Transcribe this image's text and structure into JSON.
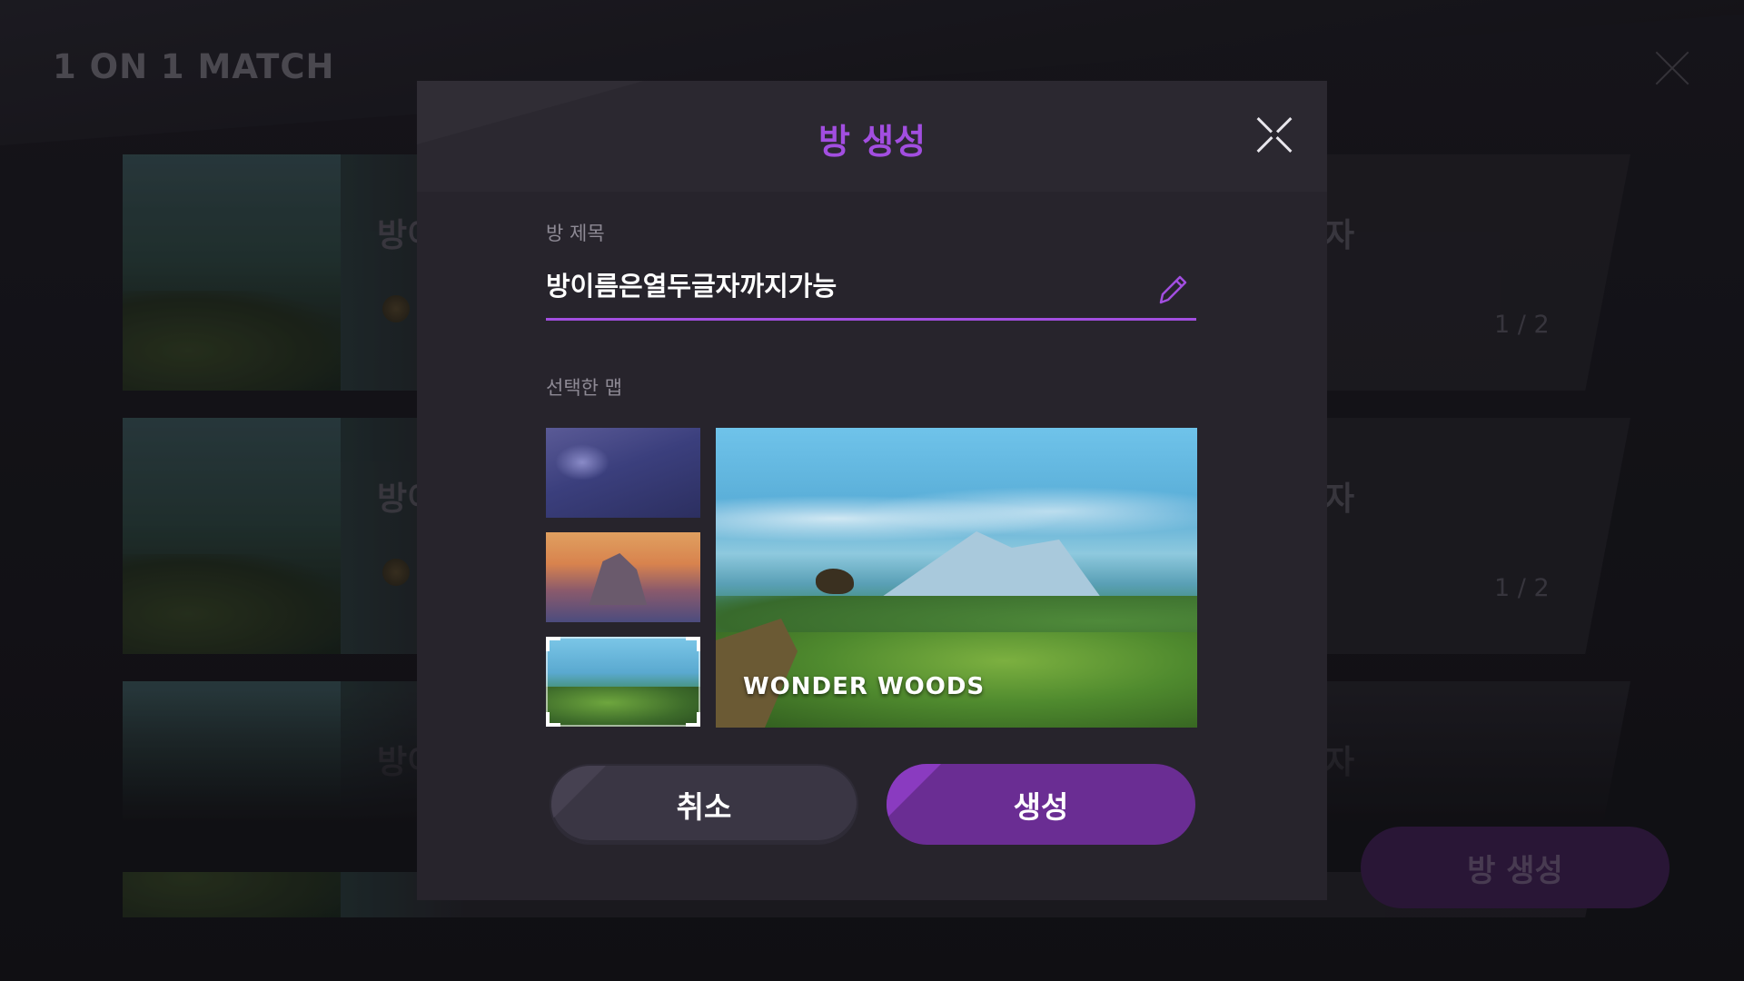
{
  "lobby": {
    "title": "1 ON 1 MATCH",
    "rooms": [
      {
        "name": "방이",
        "status": "자",
        "count": "1 / 2"
      },
      {
        "name": "방이",
        "status": "자",
        "count": "1 / 2"
      },
      {
        "name": "방이",
        "status": "자",
        "count": ""
      }
    ],
    "create_button": "방 생성"
  },
  "modal": {
    "title": "방 생성",
    "room_title_label": "방 제목",
    "room_title_value": "방이름은열두글자까지가능",
    "selected_map_label": "선택한 맵",
    "maps": [
      {
        "id": "night-forest",
        "selected": false
      },
      {
        "id": "sunset-cliff",
        "selected": false
      },
      {
        "id": "wonder-woods",
        "selected": true
      }
    ],
    "preview_map_name": "WONDER WOODS",
    "cancel_button": "취소",
    "create_button": "생성"
  },
  "colors": {
    "accent": "#a24ee0",
    "create_button": "#6a2d93",
    "cancel_button": "#3a3644",
    "modal_bg": "#27242c"
  },
  "icons": {
    "close": "close-icon",
    "edit": "pencil-icon"
  }
}
